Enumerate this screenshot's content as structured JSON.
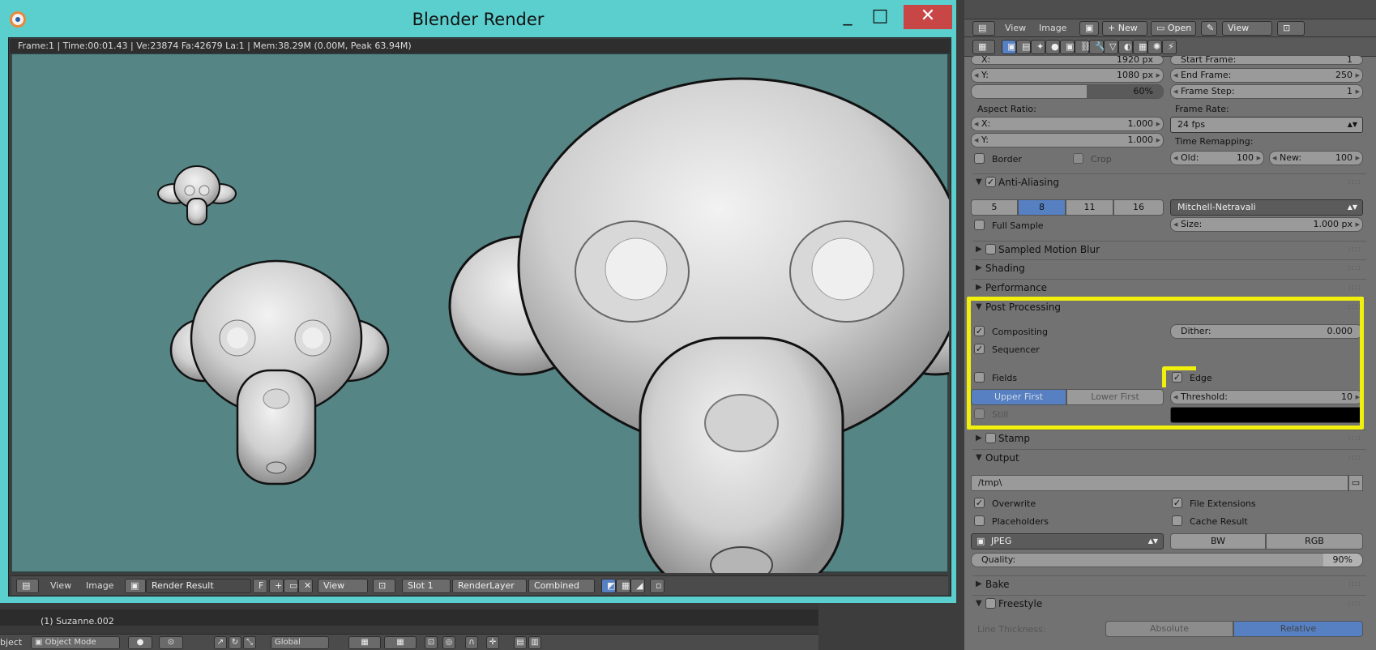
{
  "window": {
    "title": "Blender Render",
    "min": "_",
    "max": "□",
    "close": "✕"
  },
  "render_info": "Frame:1 | Time:00:01.43 | Ve:23874 Fa:42679 La:1 | Mem:38.29M (0.00M, Peak 63.94M)",
  "image_footer": {
    "view": "View",
    "image": "Image",
    "render_result": "Render Result",
    "f": "F",
    "view_btn": "View",
    "slot": "Slot 1",
    "render_layer": "RenderLayer",
    "pass": "Combined"
  },
  "viewport": {
    "object_label": "(1) Suzanne.002",
    "mode_prefix": "bject",
    "mode": "Object Mode",
    "orientation": "Global"
  },
  "props_top": {
    "view": "View",
    "image": "Image",
    "new": "New",
    "open": "Open",
    "view2": "View"
  },
  "resolution": {
    "x_label": "X:",
    "x_value": "1920 px",
    "y_label": "Y:",
    "y_value": "1080 px",
    "percent": "60%",
    "percent_value": 0.6
  },
  "frames": {
    "start_label": "Start Frame:",
    "start_value": "1",
    "end_label": "End Frame:",
    "end_value": "250",
    "step_label": "Frame Step:",
    "step_value": "1"
  },
  "aspect": {
    "label": "Aspect Ratio:",
    "x_label": "X:",
    "x_value": "1.000",
    "y_label": "Y:",
    "y_value": "1.000"
  },
  "frame_rate": {
    "label": "Frame Rate:",
    "value": "24 fps",
    "remap_label": "Time Remapping:",
    "old_label": "Old:",
    "old_value": "100",
    "new_label": "New:",
    "new_value": "100"
  },
  "border": {
    "border": "Border",
    "crop": "Crop"
  },
  "anti_aliasing": {
    "title": "Anti-Aliasing",
    "samples": [
      "5",
      "8",
      "11",
      "16"
    ],
    "selected": "8",
    "filter": "Mitchell-Netravali",
    "full_sample": "Full Sample",
    "size_label": "Size:",
    "size_value": "1.000 px"
  },
  "panels": {
    "motion_blur": "Sampled Motion Blur",
    "shading": "Shading",
    "performance": "Performance",
    "post_processing": "Post Processing",
    "stamp": "Stamp",
    "output": "Output",
    "bake": "Bake",
    "freestyle": "Freestyle"
  },
  "post": {
    "compositing": "Compositing",
    "sequencer": "Sequencer",
    "dither_label": "Dither:",
    "dither_value": "0.000",
    "fields": "Fields",
    "edge": "Edge",
    "upper_first": "Upper First",
    "lower_first": "Lower First",
    "threshold_label": "Threshold:",
    "threshold_value": "10",
    "still": "Still"
  },
  "output": {
    "path": "/tmp\\",
    "overwrite": "Overwrite",
    "file_ext": "File Extensions",
    "placeholders": "Placeholders",
    "cache": "Cache Result",
    "format": "JPEG",
    "bw": "BW",
    "rgb": "RGB",
    "quality_label": "Quality:",
    "quality_value": "90%",
    "quality_fraction": 0.9
  },
  "freestyle": {
    "line_thickness": "Line Thickness:",
    "absolute": "Absolute",
    "relative": "Relative"
  },
  "colors": {
    "window_frame": "#5bcfce",
    "render_bg": "#558585",
    "highlight": "#f0f00c",
    "close_btn": "#c84646",
    "selected": "#5680c2"
  }
}
